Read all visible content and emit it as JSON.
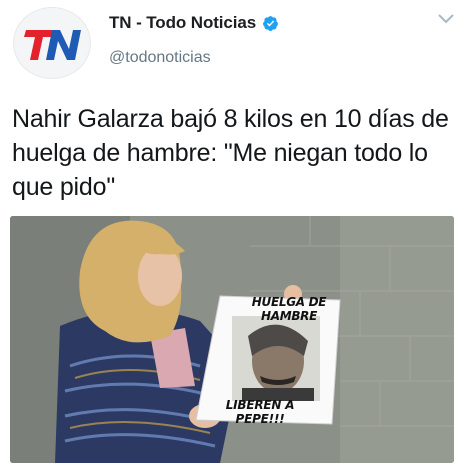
{
  "account": {
    "display_name": "TN - Todo Noticias",
    "handle": "@todonoticias",
    "logo_text": "TN"
  },
  "tweet": {
    "text": "Nahir Galarza bajó 8 kilos en 10 días de huelga de hambre: \"Me niegan todo lo que pido\""
  },
  "media": {
    "sign_top": "HUELGA DE HAMBRE",
    "sign_bottom": "LIBEREN A PEPE!!!"
  },
  "icons": {
    "verified": "verified-badge-icon",
    "menu": "chevron-down-icon"
  },
  "colors": {
    "verified_blue": "#1da1f2",
    "logo_red": "#e4222b",
    "logo_blue": "#1f5bb5",
    "handle_gray": "#657786"
  }
}
